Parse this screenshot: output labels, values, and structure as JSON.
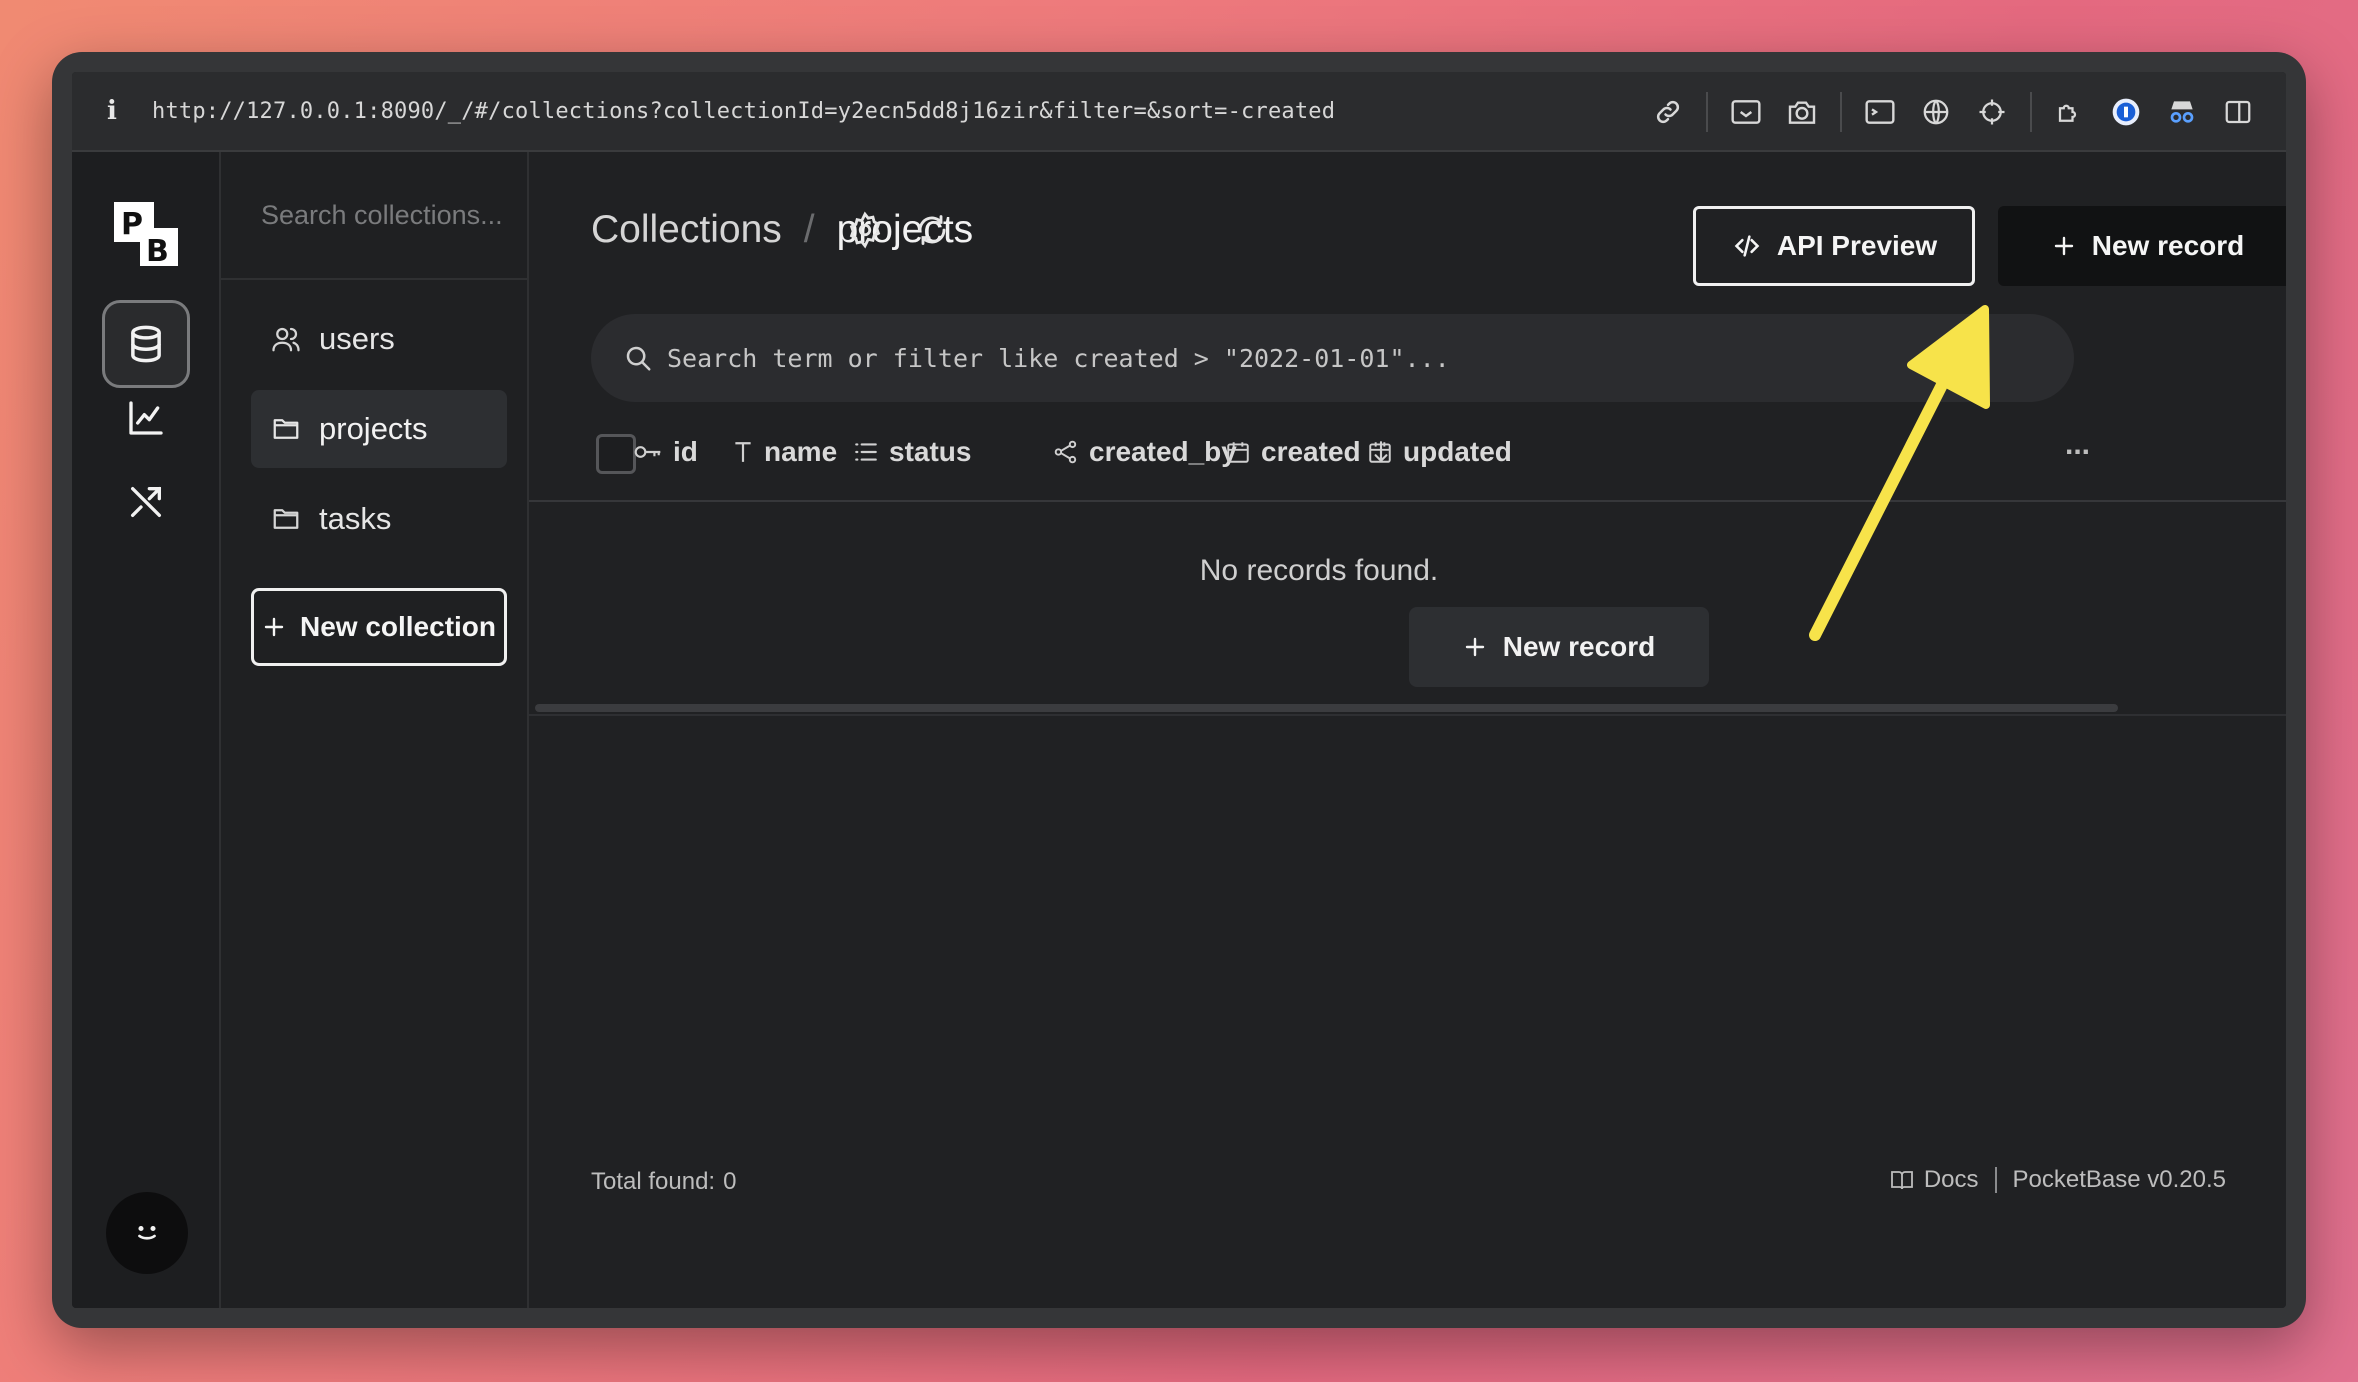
{
  "browser": {
    "info_label": "i",
    "url": "http://127.0.0.1:8090/_/#/collections?collectionId=y2ecn5dd8j16zir&filter=&sort=-created",
    "toolbar_icons": [
      "link-icon",
      "screenshot-area-icon",
      "camera-icon",
      "terminal-icon",
      "globe-icon",
      "crosshair-icon",
      "extensions-icon",
      "password-manager-icon",
      "incognito-icon",
      "sidebar-toggle-icon"
    ]
  },
  "app": {
    "logo_letters": "PB",
    "rail_items": [
      "collections-icon",
      "logs-chart-icon",
      "settings-tools-icon"
    ],
    "avatar": "smiley-avatar"
  },
  "sidebar": {
    "search_placeholder": "Search collections...",
    "items": [
      {
        "label": "users",
        "icon": "users-icon",
        "active": false
      },
      {
        "label": "projects",
        "icon": "folder-icon",
        "active": true
      },
      {
        "label": "tasks",
        "icon": "folder-icon",
        "active": false
      }
    ],
    "new_collection_label": "New collection"
  },
  "header": {
    "breadcrumb_root": "Collections",
    "breadcrumb_sep": "/",
    "breadcrumb_current": "projects",
    "api_preview_label": "API Preview",
    "new_record_label": "New record"
  },
  "search": {
    "placeholder": "Search term or filter like created > \"2022-01-01\"..."
  },
  "table": {
    "columns": [
      {
        "label": "id",
        "icon": "key-icon"
      },
      {
        "label": "name",
        "icon": "text-type-icon"
      },
      {
        "label": "status",
        "icon": "list-icon"
      },
      {
        "label": "created_by",
        "icon": "relation-icon"
      },
      {
        "label": "created",
        "icon": "calendar-icon",
        "sorted": "desc"
      },
      {
        "label": "updated",
        "icon": "calendar-icon"
      }
    ],
    "more_label": "...",
    "empty_message": "No records found.",
    "empty_new_record_label": "New record"
  },
  "footer": {
    "total_label": "Total found:",
    "total_count": "0",
    "docs_label": "Docs",
    "version_label": "PocketBase v0.20.5"
  },
  "colors": {
    "accent_arrow": "#f7e34a",
    "background": "#1f2022",
    "active_item": "#2d2f32"
  }
}
